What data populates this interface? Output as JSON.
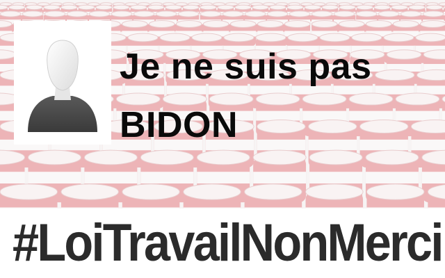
{
  "colors": {
    "statement_text": "#0a0a0a",
    "hashtag_text": "#2b2b2b",
    "barrel_red": "#e07f84",
    "barrel_white": "#f7f3f3",
    "band_background": "#ffffff"
  },
  "avatar": {
    "icon": "default-user-silhouette-icon"
  },
  "statement": {
    "line1": "Je ne suis pas",
    "line2": "BIDON"
  },
  "hashtag": "#LoiTravailNonMerci"
}
